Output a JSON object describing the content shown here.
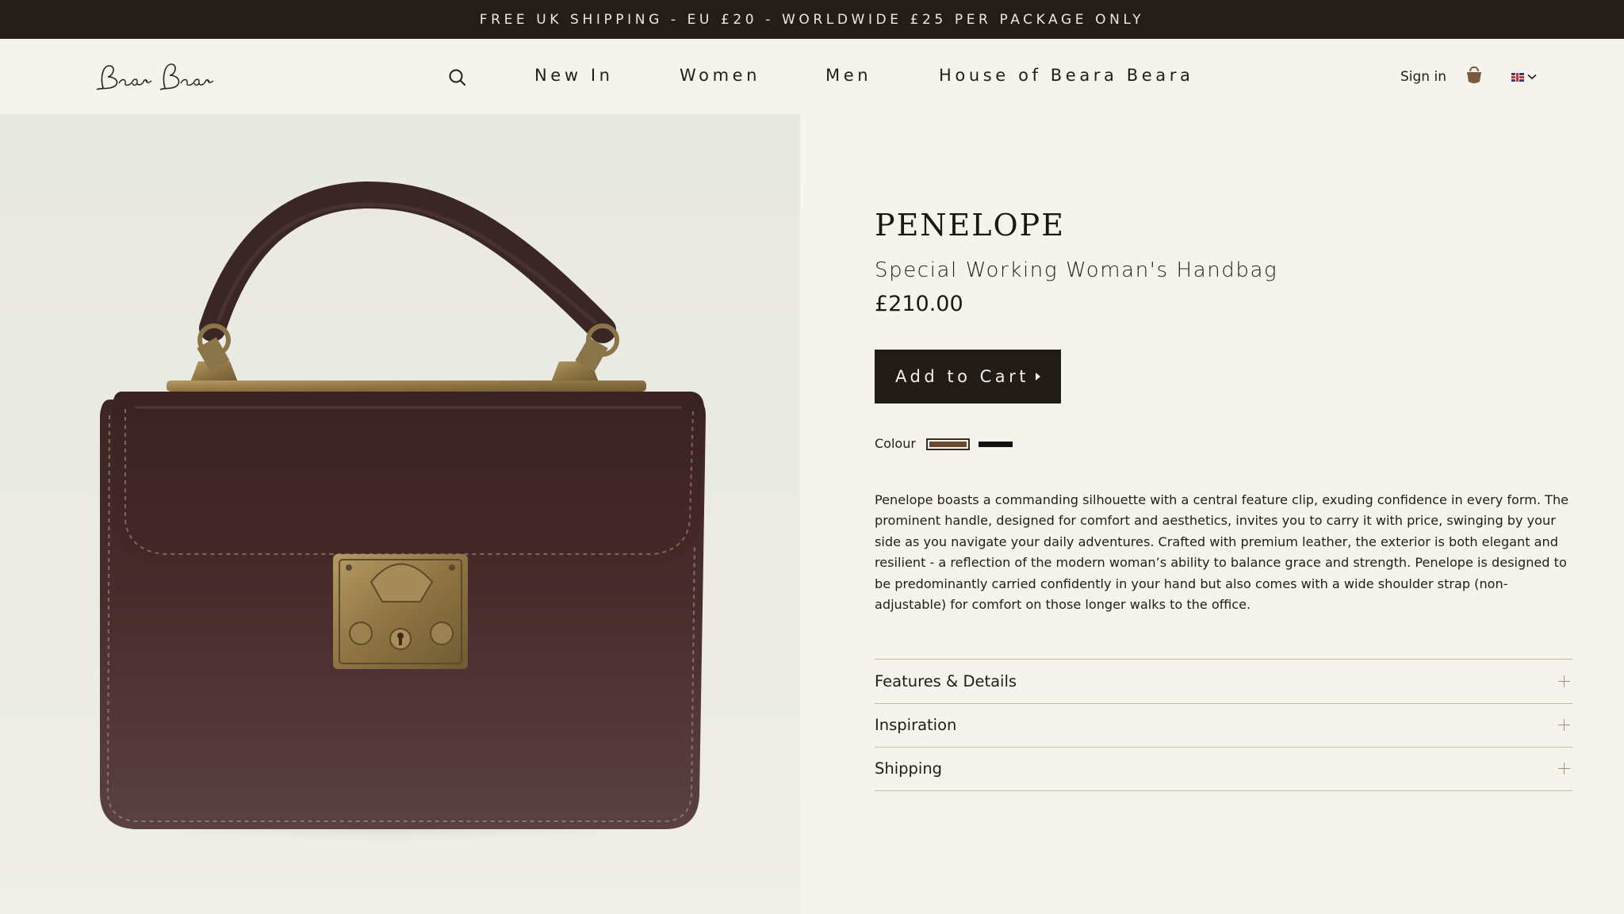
{
  "announcement": "FREE UK SHIPPING - EU £20 - WORLDWIDE £25 PER PACKAGE ONLY",
  "header": {
    "logo_text": "Beara Beara",
    "nav": [
      "New In",
      "Women",
      "Men",
      "House of Beara Beara"
    ],
    "signin": "Sign in",
    "icons": [
      "search-icon",
      "bag-icon",
      "uk-flag-icon",
      "chevron-down-icon"
    ]
  },
  "product": {
    "name": "PENELOPE",
    "subtitle": "Special Working Woman's Handbag",
    "price": "£210.00",
    "add_to_cart": "Add to Cart",
    "colour_label": "Colour",
    "swatches": [
      {
        "name": "brown",
        "color": "#6b4a2f",
        "selected": true
      },
      {
        "name": "black",
        "color": "#161211",
        "selected": false
      }
    ],
    "description": "Penelope boasts a commanding silhouette with a central feature clip, exuding confidence in every form. The prominent handle, designed for comfort and aesthetics, invites you to carry it with price, swinging by your side as you navigate your daily adventures. Crafted with premium leather, the exterior is both elegant and resilient - a reflection of the modern woman’s ability to balance grace and strength. Penelope is designed to be predominantly carried confidently in your hand but also comes with a wide shoulder strap (non-adjustable) for comfort on those longer walks to the office."
  },
  "accordion": [
    "Features & Details",
    "Inspiration",
    "Shipping"
  ],
  "colors": {
    "topbar": "#231d1a",
    "background": "#f4f3ec",
    "button": "#221c19",
    "bag_leather": "#4a2d2c",
    "hardware": "#9c8354"
  }
}
